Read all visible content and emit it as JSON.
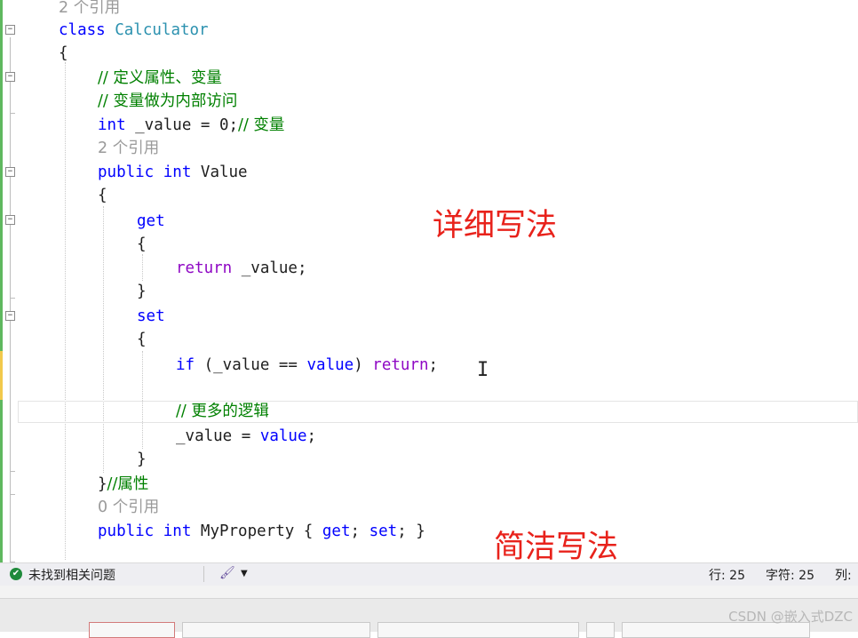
{
  "editor": {
    "lines": {
      "l1_refs": "2 个引用",
      "l2_class_kw": "class",
      "l2_class_name": "Calculator",
      "l3_brace": "{",
      "l4_comment": "// 定义属性、变量",
      "l5_comment": "// 变量做为内部访问",
      "l6_type": "int",
      "l6_code": " _value = 0;",
      "l6_comment": "// 变量",
      "l7_refs": "2 个引用",
      "l8_public": "public",
      "l8_int": "int",
      "l8_name": " Value",
      "l9_brace": "{",
      "l10_get": "get",
      "l11_brace": "{",
      "l12_return": "return",
      "l12_code": " _value;",
      "l13_brace": "}",
      "l14_set": "set",
      "l15_brace": "{",
      "l16_if": "if",
      "l16_code": " (_value == ",
      "l16_value": "value",
      "l16_paren": ") ",
      "l16_return": "return",
      "l16_semi": ";",
      "l17_comment": "// 更多的逻辑",
      "l18_code": "_value = ",
      "l18_value": "value",
      "l18_semi": ";",
      "l19_brace": "}",
      "l20_brace": "}",
      "l20_comment": "//属性",
      "l21_refs": "0 个引用",
      "l22_public": "public",
      "l22_int": "int",
      "l22_name": " MyProperty { ",
      "l22_get": "get",
      "l22_mid": "; ",
      "l22_set": "set",
      "l22_end": "; }"
    }
  },
  "annotations": {
    "detailed": "详细写法",
    "concise": "简洁写法"
  },
  "statusbar": {
    "issues_text": "未找到相关问题",
    "line": "行: 25",
    "char": "字符: 25",
    "col": "列:"
  },
  "watermark": "CSDN @嵌入式DZC",
  "colors": {
    "keyword": "#0000ff",
    "control": "#8f08c4",
    "type": "#2b91af",
    "comment": "#008000",
    "annotation": "#e8221b"
  }
}
